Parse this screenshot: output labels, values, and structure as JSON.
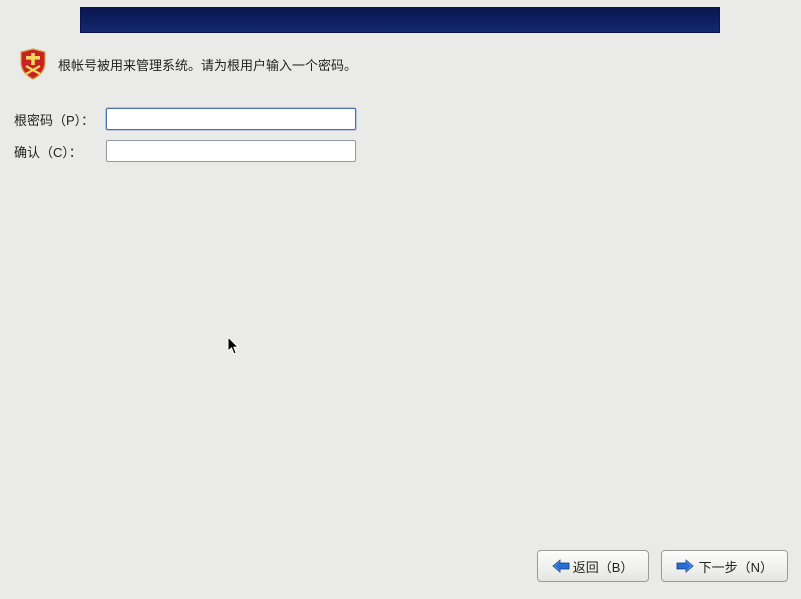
{
  "intro": {
    "text": "根帐号被用来管理系统。请为根用户输入一个密码。"
  },
  "form": {
    "password_label": "根密码（P）：",
    "confirm_label": "确认（C）：",
    "password_value": "",
    "confirm_value": ""
  },
  "buttons": {
    "back_label": "返回（B）",
    "next_label": "下一步（N）"
  },
  "icons": {
    "shield": "shield-icon",
    "arrow_left": "arrow-left-icon",
    "arrow_right": "arrow-right-icon"
  }
}
